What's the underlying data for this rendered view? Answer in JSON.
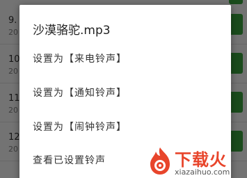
{
  "background_list": {
    "rows": [
      {
        "index": "9.",
        "sub": "20"
      },
      {
        "index": "10",
        "sub": "20"
      },
      {
        "index": "11",
        "sub": "20"
      },
      {
        "index": "12",
        "sub": "20"
      }
    ]
  },
  "dialog": {
    "title": "沙漠骆驼.mp3",
    "items": [
      {
        "label": "设置为【来电铃声】"
      },
      {
        "label": "设置为【通知铃声】"
      },
      {
        "label": "设置为【闹钟铃声】"
      },
      {
        "label": "查看已设置铃声"
      }
    ]
  },
  "watermark": {
    "name": "下载火",
    "url": "xiazaihuo.com"
  },
  "colors": {
    "accent_green": "#3aa73e",
    "watermark_red": "#e8452b"
  }
}
